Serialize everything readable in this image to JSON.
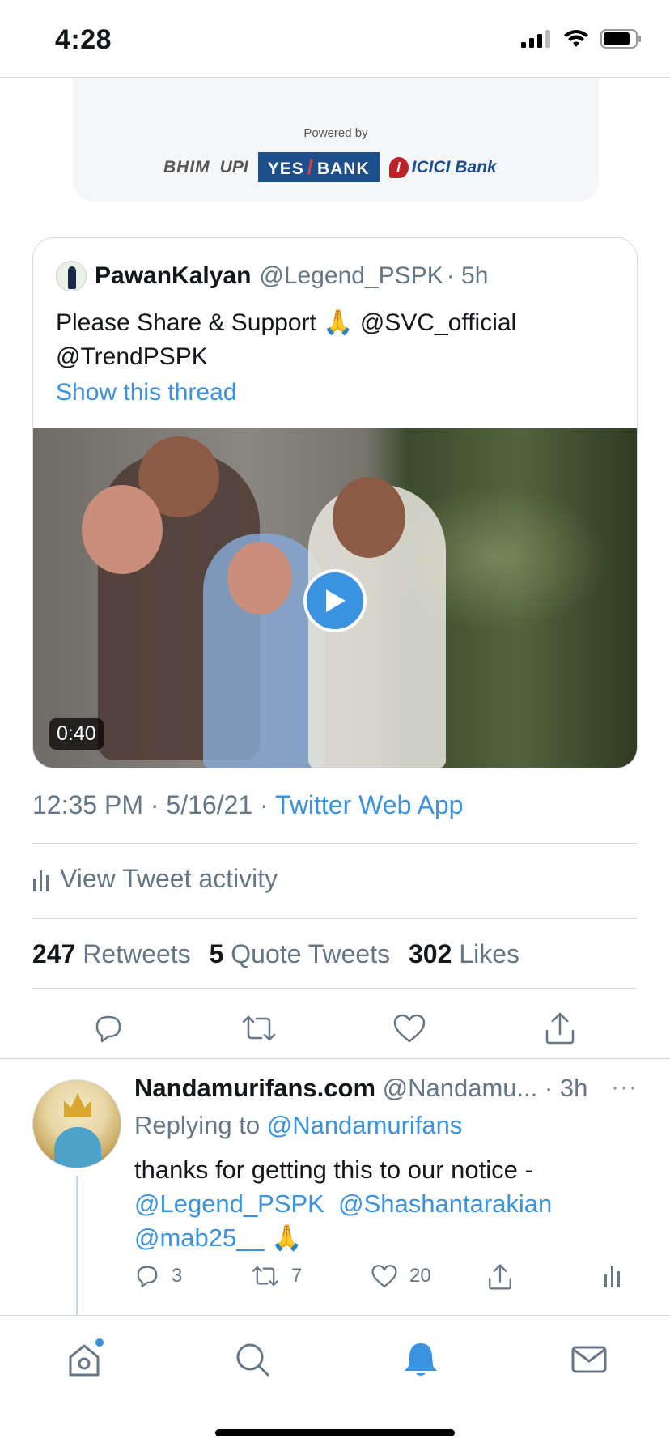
{
  "status_bar": {
    "time": "4:28"
  },
  "banner": {
    "powered_by": "Powered by",
    "logos": {
      "bhim": "BHIM",
      "upi": "UPI",
      "yes_bank_1": "YES",
      "yes_bank_2": "BANK",
      "icici": "ICICI Bank"
    }
  },
  "quoted_tweet": {
    "name": "PawanKalyan",
    "handle": "@Legend_PSPK",
    "time": "· 5h",
    "text_line1": "Please Share &  Support 🙏 @SVC_official",
    "text_line2": "@TrendPSPK",
    "show_thread": "Show this thread",
    "video_duration": "0:40"
  },
  "tweet": {
    "timestamp": "12:35 PM · 5/16/21 · ",
    "source": "Twitter Web App",
    "view_activity": "View Tweet activity",
    "retweets_count": "247",
    "retweets_label": "Retweets",
    "quotes_count": "5",
    "quotes_label": "Quote Tweets",
    "likes_count": "302",
    "likes_label": "Likes"
  },
  "reply": {
    "name": "Nandamurifans.com",
    "handle": "@Nandamu...",
    "time": "· 3h",
    "more": "···",
    "replying_prefix": "Replying to ",
    "replying_to": "@Nandamurifans",
    "text": "thanks for getting this to our notice  -",
    "mention1": "@Legend_PSPK",
    "mention2": "@Shashantarakian",
    "mention3": "@mab25__",
    "emoji": "🙏",
    "reply_count": "3",
    "retweet_count": "7",
    "like_count": "20"
  },
  "colors": {
    "accent": "#3a92e0",
    "muted": "#657786",
    "divider": "#d6dbe0"
  },
  "icons": [
    "signal-icon",
    "wifi-icon",
    "battery-icon",
    "reply-icon",
    "retweet-icon",
    "like-icon",
    "share-icon",
    "analytics-icon",
    "home-icon",
    "search-icon",
    "notifications-icon",
    "messages-icon"
  ]
}
